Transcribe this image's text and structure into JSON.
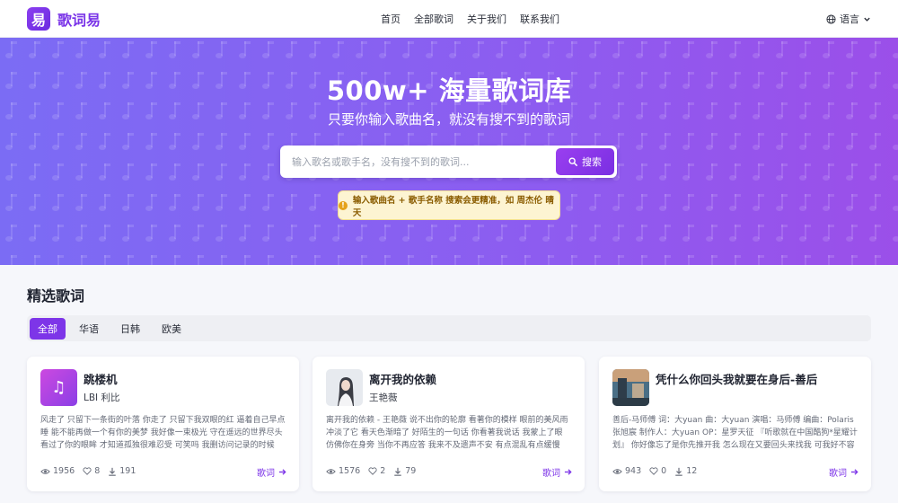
{
  "brand": {
    "logo_char": "易",
    "name": "歌词易"
  },
  "nav": {
    "items": [
      "首页",
      "全部歌词",
      "关于我们",
      "联系我们"
    ],
    "language": "语言"
  },
  "hero": {
    "title": "500w+ 海量歌词库",
    "subtitle": "只要你输入歌曲名，就没有搜不到的歌词",
    "search_placeholder": "输入歌名或歌手名，没有搜不到的歌词...",
    "search_button": "搜索",
    "tip": "输入歌曲名 + 歌手名称 搜索会更精准，如 周杰伦 晴天"
  },
  "section": {
    "title": "精选歌词",
    "tabs": [
      {
        "label": "全部",
        "active": true
      },
      {
        "label": "华语",
        "active": false
      },
      {
        "label": "日韩",
        "active": false
      },
      {
        "label": "欧美",
        "active": false
      }
    ]
  },
  "cards": [
    {
      "title": "跳楼机",
      "artist": "LBI 利比",
      "excerpt": "风走了 只留下一条街的叶落 你走了 只留下我双眼的红 逼着自己早点睡 能不能再做一个有你的美梦 我好像一束极光 守在遥远的世界尽头 看过了你的眼眸 才知道孤独很难忍受 可笑吗 我删访问记录的时候有...",
      "views": "1956",
      "likes": "8",
      "downloads": "191",
      "link": "歌词"
    },
    {
      "title": "离开我的依赖",
      "artist": "王艳薇",
      "excerpt": "离开我的依赖 - 王艳薇 说不出你的轮廓 看著你的模样 眼前的美风雨冲淡了它 看天色渐暗了 好陌生的一句话 你看著我说话 我蒙上了眼 仿佛你在身旁 当你不再应答 我来不及遗声不安 有点混乱有点缓慢 才...",
      "views": "1576",
      "likes": "2",
      "downloads": "79",
      "link": "歌词"
    },
    {
      "title": "凭什么你回头我就要在身后-善后",
      "artist": "",
      "excerpt": "善后-马师傅 词：大yuan 曲：大yuan 演唱：马师傅 编曲：Polaris 张旭宸 制作人：大yuan OP：星罗天征 『听歌就在中国酷狗*星耀计划』 你好像忘了是你先推开我 怎么现在又要回头来找我 可我好不容易才...",
      "views": "943",
      "likes": "0",
      "downloads": "12",
      "link": "歌词"
    }
  ]
}
